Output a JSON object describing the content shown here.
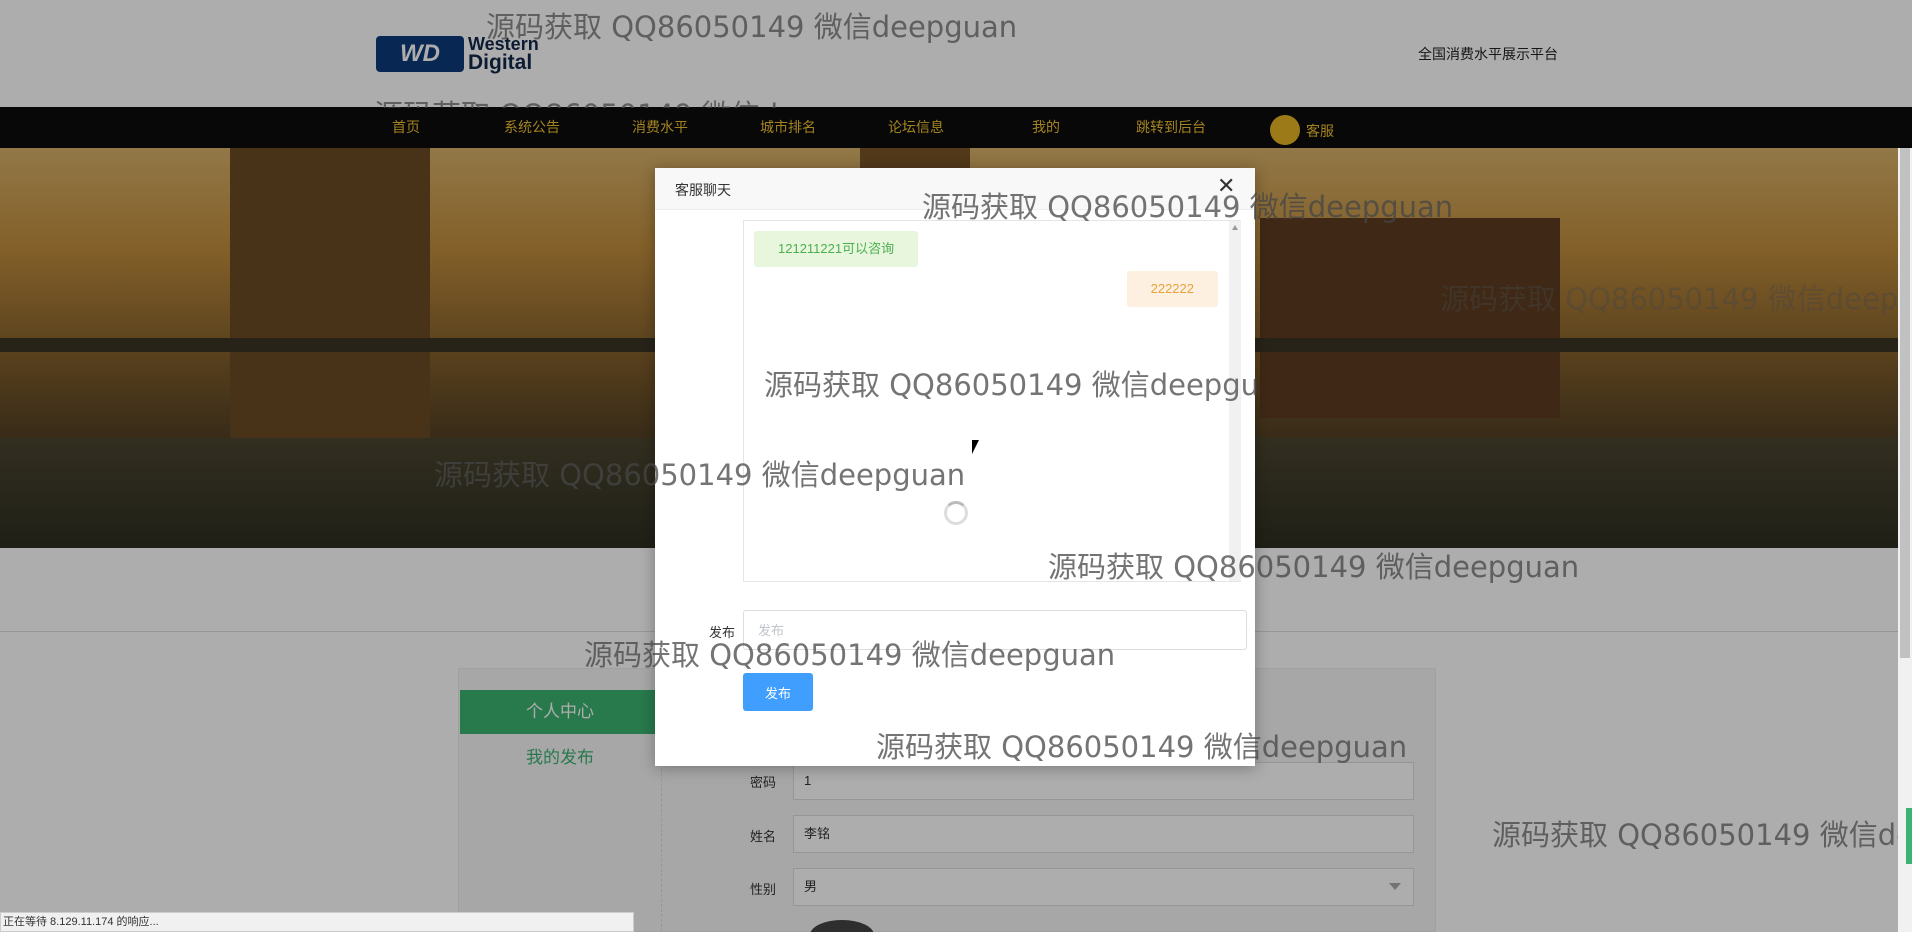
{
  "header": {
    "logo_badge": "WD",
    "logo_word1": "Western",
    "logo_word2": "Digital",
    "platform_title": "全国消费水平展示平台"
  },
  "nav": {
    "items": [
      "首页",
      "系统公告",
      "消费水平",
      "城市排名",
      "论坛信息",
      "我的",
      "跳转到后台"
    ],
    "customer_service": "客服"
  },
  "sidebar": {
    "active": "个人中心",
    "item": "我的发布"
  },
  "profile_form": {
    "password_label": "密码",
    "password_value": "1",
    "name_label": "姓名",
    "name_value": "李铭",
    "gender_label": "性别",
    "gender_value": "男"
  },
  "chat_modal": {
    "title": "客服聊天",
    "close": "✕",
    "incoming_message": "121211221可以咨询",
    "outgoing_message": "222222",
    "post_label": "发布",
    "post_placeholder": "发布",
    "post_button": "发布"
  },
  "watermark": "源码获取 QQ86050149 微信deepguan",
  "status_bar": "正在等待 8.129.11.174 的响应..."
}
